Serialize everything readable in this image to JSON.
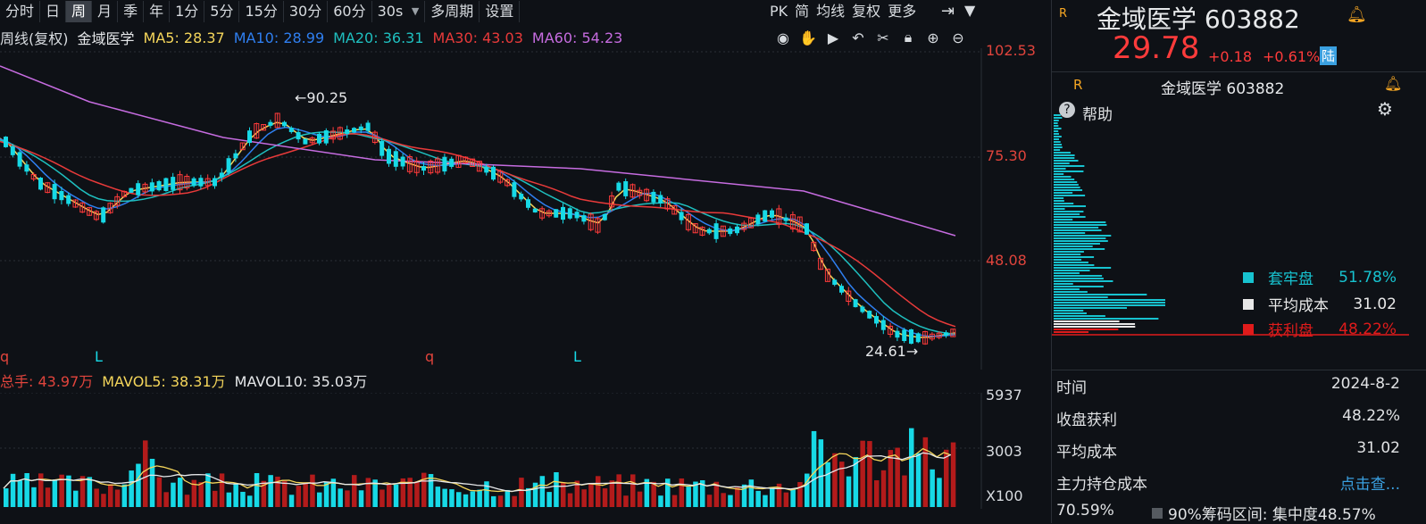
{
  "toolbar": {
    "items": [
      "分时",
      "日",
      "周",
      "月",
      "季",
      "年",
      "1分",
      "5分",
      "15分",
      "30分",
      "60分",
      "30s",
      "多周期",
      "设置"
    ],
    "active_index": 2,
    "right_items": [
      "PK",
      "简",
      "均线",
      "复权",
      "更多"
    ]
  },
  "ma_row": {
    "prefix": "周线(复权)",
    "stock": "金域医学",
    "ma5": "MA5: 28.37",
    "ma10": "MA10: 28.99",
    "ma20": "MA20: 36.31",
    "ma30": "MA30: 43.03",
    "ma60": "MA60: 54.23"
  },
  "price_axis": [
    "102.53",
    "75.30",
    "48.08"
  ],
  "annotations": {
    "high": "90.25",
    "low": "24.61"
  },
  "period_marks": [
    "L",
    "q",
    "L",
    "q"
  ],
  "volume_row": {
    "total": "总手: 43.97万",
    "mavol5": "MAVOL5: 38.31万",
    "mavol10": "MAVOL10: 35.03万"
  },
  "volume_axis": [
    "5937",
    "3003",
    "X100"
  ],
  "right": {
    "title": "金域医学 603882",
    "r_tag": "R",
    "price": "29.78",
    "change": "+0.18",
    "change_pct": "+0.61%",
    "badge": "陆",
    "sub_title": "金域医学 603882",
    "help": "帮助",
    "legend": [
      {
        "label": "套牢盘",
        "value": "51.78%",
        "color": "#17c3d0"
      },
      {
        "label": "平均成本",
        "value": "31.02",
        "color": "#e8e8e8"
      },
      {
        "label": "获利盘",
        "value": "48.22%",
        "color": "#e01b1b"
      }
    ],
    "rows": [
      {
        "label": "时间",
        "value": "2024-8-2"
      },
      {
        "label": "收盘获利",
        "value": "48.22%"
      },
      {
        "label": "平均成本",
        "value": "31.02"
      },
      {
        "label": "主力持仓成本",
        "value": "点击查..."
      }
    ],
    "footer_left": "70.59%",
    "footer_right": "90%筹码区间: 集中度48.57%"
  },
  "colors": {
    "up": "#ff3b3b",
    "down": "#17d9e6",
    "ma5": "#f5d65b",
    "ma10": "#2f7ff0",
    "ma20": "#1fbfbf",
    "ma30": "#e83a3a",
    "ma60": "#c66ce0"
  }
}
